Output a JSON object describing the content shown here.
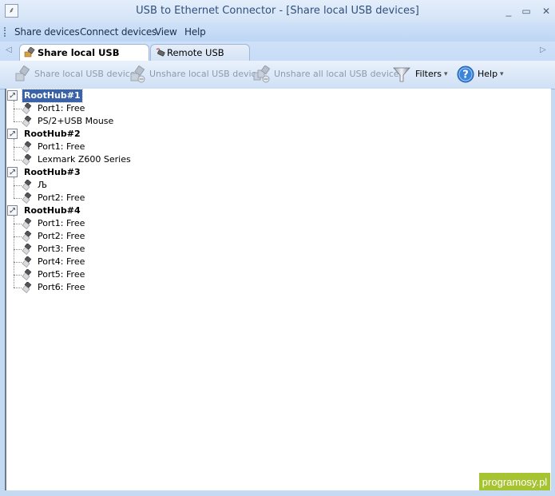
{
  "window": {
    "title": "USB to Ethernet Connector - [Share local USB devices]",
    "icon": "usb-icon",
    "controls": {
      "minimize": "_",
      "maximize": "▭",
      "close": "✕"
    }
  },
  "menu": {
    "items": [
      {
        "label": "Share devices"
      },
      {
        "label": "Connect devices"
      },
      {
        "label": "View"
      },
      {
        "label": "Help"
      }
    ]
  },
  "tabs": {
    "scroll_left": "◁",
    "scroll_right": "▷",
    "items": [
      {
        "label": "Share local USB devices",
        "active": true,
        "icon": "share-usb-icon"
      },
      {
        "label": "Remote USB devices",
        "active": false,
        "icon": "remote-usb-icon"
      }
    ]
  },
  "toolbar": {
    "share": {
      "label": "Share local USB device",
      "enabled": false
    },
    "unshare": {
      "label": "Unshare local USB device",
      "enabled": false
    },
    "unshare_all": {
      "label": "Unshare all local USB devices",
      "enabled": false
    },
    "filters": {
      "label": "Filters",
      "dropdown": "▾"
    },
    "help": {
      "label": "Help",
      "dropdown": "▾"
    }
  },
  "tree": {
    "hubs": [
      {
        "label": "RootHub#1",
        "selected": true,
        "children": [
          "Port1: Free",
          "PS/2+USB Mouse"
        ]
      },
      {
        "label": "RootHub#2",
        "selected": false,
        "children": [
          "Port1: Free",
          "Lexmark Z600 Series"
        ]
      },
      {
        "label": "RootHub#3",
        "selected": false,
        "children": [
          "Љ",
          "Port2: Free"
        ]
      },
      {
        "label": "RootHub#4",
        "selected": false,
        "children": [
          "Port1: Free",
          "Port2: Free",
          "Port3: Free",
          "Port4: Free",
          "Port5: Free",
          "Port6: Free"
        ]
      }
    ]
  },
  "watermark": {
    "text": "programosy.pl",
    "color": "#a6c432"
  }
}
